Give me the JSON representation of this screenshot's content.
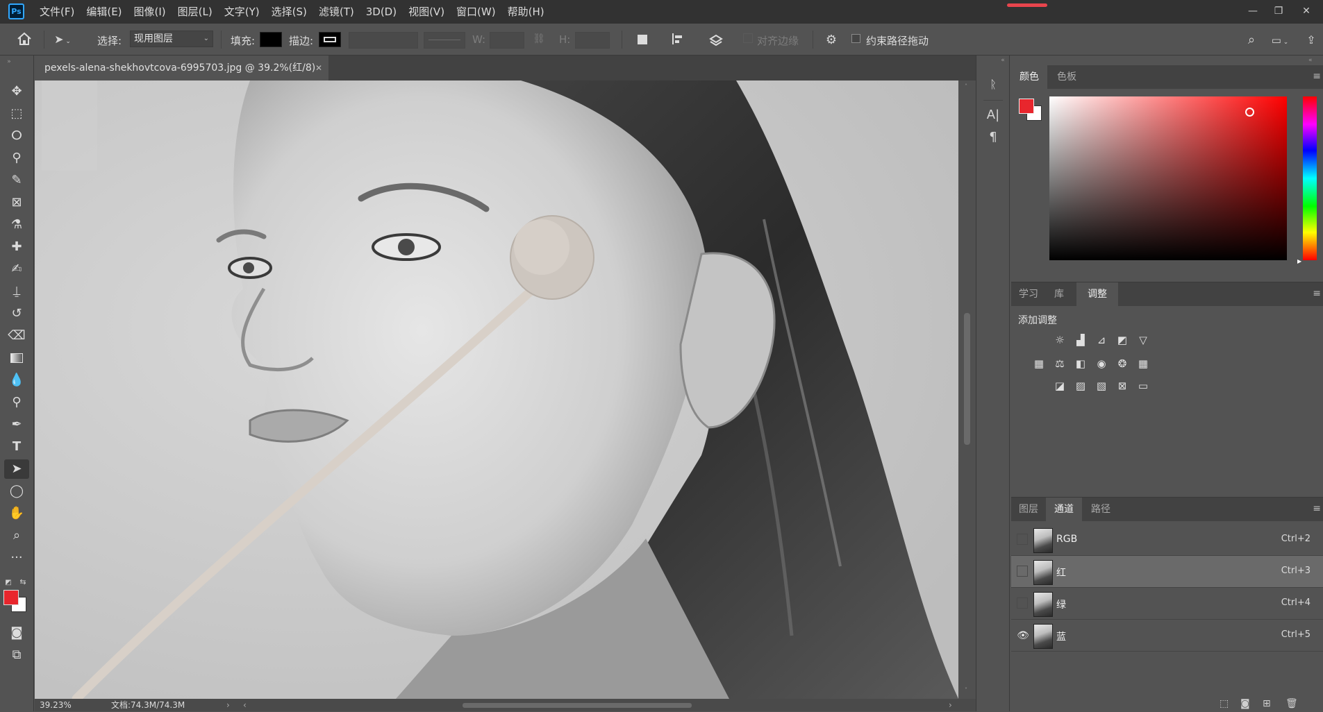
{
  "app": {
    "logo": "Ps",
    "accent": "#31a8ff"
  },
  "menu": [
    "文件(F)",
    "编辑(E)",
    "图像(I)",
    "图层(L)",
    "文字(Y)",
    "选择(S)",
    "滤镜(T)",
    "3D(D)",
    "视图(V)",
    "窗口(W)",
    "帮助(H)"
  ],
  "options": {
    "select_label": "选择:",
    "select_value": "现用图层",
    "fill_label": "填充:",
    "stroke_label": "描边:",
    "w_label": "W:",
    "h_label": "H:",
    "align_edges_label": "对齐边缘",
    "constrain_label": "约束路径拖动",
    "fill_color": "#000000",
    "stroke_color": "#000000"
  },
  "document": {
    "tab_title": "pexels-alena-shekhovtcova-6995703.jpg  @  39.2%(红/8)",
    "zoom": "39.23%",
    "doc_size": "文档:74.3M/74.3M"
  },
  "colors": {
    "foreground": "#e8262d",
    "background": "#ffffff"
  },
  "color_panel": {
    "tabs": [
      "颜色",
      "色板"
    ],
    "active": "颜色"
  },
  "adjust_panel": {
    "tabs": [
      "学习",
      "库",
      "调整"
    ],
    "active": "调整",
    "heading": "添加调整"
  },
  "channels_panel": {
    "tabs": [
      "图层",
      "通道",
      "路径"
    ],
    "active": "通道",
    "channels": [
      {
        "name": "RGB",
        "shortcut": "Ctrl+2",
        "visible": false,
        "selected": false
      },
      {
        "name": "红",
        "shortcut": "Ctrl+3",
        "visible": false,
        "selected": true
      },
      {
        "name": "绿",
        "shortcut": "Ctrl+4",
        "visible": false,
        "selected": false
      },
      {
        "name": "蓝",
        "shortcut": "Ctrl+5",
        "visible": true,
        "selected": false
      }
    ]
  }
}
